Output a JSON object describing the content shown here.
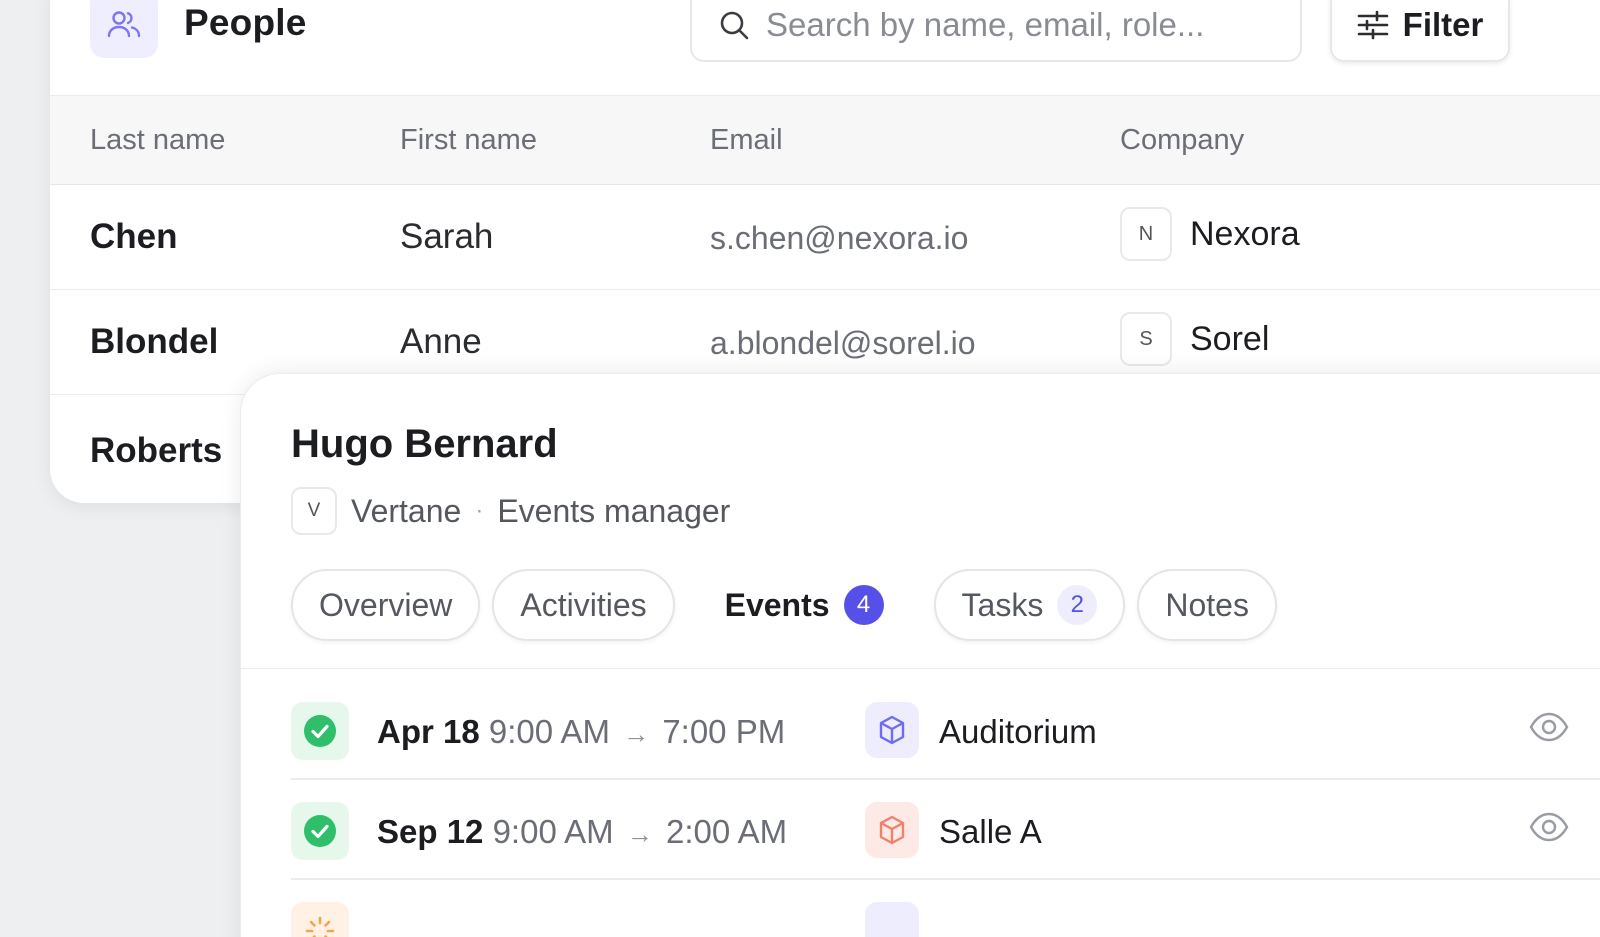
{
  "people": {
    "title": "People",
    "search_placeholder": "Search by name, email, role...",
    "filter_label": "Filter",
    "columns": [
      "Last name",
      "First name",
      "Email",
      "Company"
    ],
    "rows": [
      {
        "last": "Chen",
        "first": "Sarah",
        "email": "s.chen@nexora.io",
        "company_initial": "N",
        "company": "Nexora"
      },
      {
        "last": "Blondel",
        "first": "Anne",
        "email": "a.blondel@sorel.io",
        "company_initial": "S",
        "company": "Sorel"
      },
      {
        "last": "Roberts",
        "first": "",
        "email": "",
        "company_initial": "",
        "company": ""
      }
    ]
  },
  "detail": {
    "name": "Hugo Bernard",
    "company_initial": "V",
    "company": "Vertane",
    "separator": "·",
    "role": "Events manager",
    "tabs": [
      {
        "label": "Overview",
        "badge": ""
      },
      {
        "label": "Activities",
        "badge": ""
      },
      {
        "label": "Events",
        "badge": "4"
      },
      {
        "label": "Tasks",
        "badge": "2"
      },
      {
        "label": "Notes",
        "badge": ""
      }
    ],
    "active_tab": "Events",
    "events": [
      {
        "date": "Apr 18",
        "start": "9:00 AM",
        "end": "7:00 PM",
        "room": "Auditorium",
        "status": "confirmed",
        "room_color": "#6f6cf0"
      },
      {
        "date": "Sep 12",
        "start": "9:00 AM",
        "end": "2:00 AM",
        "room": "Salle A",
        "status": "confirmed",
        "room_color": "#f0826c"
      }
    ]
  },
  "colors": {
    "accent": "#5650e8",
    "success": "#2fbf6a",
    "success_bg": "#e6f7ec"
  }
}
